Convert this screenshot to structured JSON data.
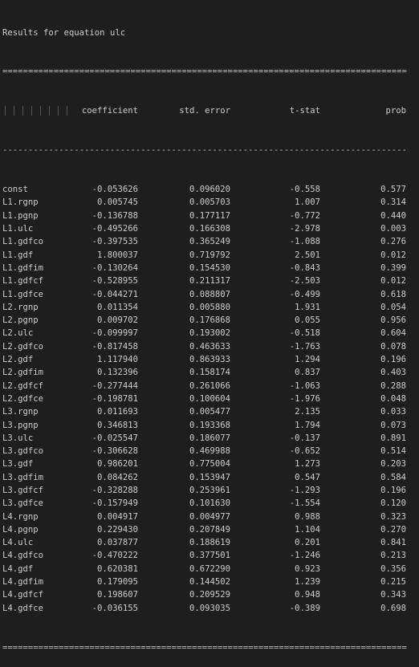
{
  "title": "Results for equation ulc",
  "separator_double": "===============================================================================",
  "separator_single": "-------------------------------------------------------------------------------",
  "columns": {
    "coefficient": "coefficient",
    "std_error": "std. error",
    "t_stat": "t-stat",
    "prob": "prob"
  },
  "rows": [
    {
      "name": "const",
      "coef": "-0.053626",
      "err": "0.096020",
      "t": "-0.558",
      "prob": "0.577"
    },
    {
      "name": "L1.rgnp",
      "coef": "0.005745",
      "err": "0.005703",
      "t": "1.007",
      "prob": "0.314"
    },
    {
      "name": "L1.pgnp",
      "coef": "-0.136788",
      "err": "0.177117",
      "t": "-0.772",
      "prob": "0.440"
    },
    {
      "name": "L1.ulc",
      "coef": "-0.495266",
      "err": "0.166308",
      "t": "-2.978",
      "prob": "0.003"
    },
    {
      "name": "L1.gdfco",
      "coef": "-0.397535",
      "err": "0.365249",
      "t": "-1.088",
      "prob": "0.276"
    },
    {
      "name": "L1.gdf",
      "coef": "1.800037",
      "err": "0.719792",
      "t": "2.501",
      "prob": "0.012"
    },
    {
      "name": "L1.gdfim",
      "coef": "-0.130264",
      "err": "0.154530",
      "t": "-0.843",
      "prob": "0.399"
    },
    {
      "name": "L1.gdfcf",
      "coef": "-0.528955",
      "err": "0.211317",
      "t": "-2.503",
      "prob": "0.012"
    },
    {
      "name": "L1.gdfce",
      "coef": "-0.044271",
      "err": "0.088807",
      "t": "-0.499",
      "prob": "0.618"
    },
    {
      "name": "L2.rgnp",
      "coef": "0.011354",
      "err": "0.005880",
      "t": "1.931",
      "prob": "0.054"
    },
    {
      "name": "L2.pgnp",
      "coef": "0.009702",
      "err": "0.176868",
      "t": "0.055",
      "prob": "0.956"
    },
    {
      "name": "L2.ulc",
      "coef": "-0.099997",
      "err": "0.193002",
      "t": "-0.518",
      "prob": "0.604"
    },
    {
      "name": "L2.gdfco",
      "coef": "-0.817458",
      "err": "0.463633",
      "t": "-1.763",
      "prob": "0.078"
    },
    {
      "name": "L2.gdf",
      "coef": "1.117940",
      "err": "0.863933",
      "t": "1.294",
      "prob": "0.196"
    },
    {
      "name": "L2.gdfim",
      "coef": "0.132396",
      "err": "0.158174",
      "t": "0.837",
      "prob": "0.403"
    },
    {
      "name": "L2.gdfcf",
      "coef": "-0.277444",
      "err": "0.261066",
      "t": "-1.063",
      "prob": "0.288"
    },
    {
      "name": "L2.gdfce",
      "coef": "-0.198781",
      "err": "0.100604",
      "t": "-1.976",
      "prob": "0.048"
    },
    {
      "name": "L3.rgnp",
      "coef": "0.011693",
      "err": "0.005477",
      "t": "2.135",
      "prob": "0.033"
    },
    {
      "name": "L3.pgnp",
      "coef": "0.346813",
      "err": "0.193368",
      "t": "1.794",
      "prob": "0.073"
    },
    {
      "name": "L3.ulc",
      "coef": "-0.025547",
      "err": "0.186077",
      "t": "-0.137",
      "prob": "0.891"
    },
    {
      "name": "L3.gdfco",
      "coef": "-0.306628",
      "err": "0.469988",
      "t": "-0.652",
      "prob": "0.514"
    },
    {
      "name": "L3.gdf",
      "coef": "0.986201",
      "err": "0.775004",
      "t": "1.273",
      "prob": "0.203"
    },
    {
      "name": "L3.gdfim",
      "coef": "0.084262",
      "err": "0.153947",
      "t": "0.547",
      "prob": "0.584"
    },
    {
      "name": "L3.gdfcf",
      "coef": "-0.328288",
      "err": "0.253961",
      "t": "-1.293",
      "prob": "0.196"
    },
    {
      "name": "L3.gdfce",
      "coef": "-0.157949",
      "err": "0.101630",
      "t": "-1.554",
      "prob": "0.120"
    },
    {
      "name": "L4.rgnp",
      "coef": "0.004917",
      "err": "0.004977",
      "t": "0.988",
      "prob": "0.323"
    },
    {
      "name": "L4.pgnp",
      "coef": "0.229430",
      "err": "0.207849",
      "t": "1.104",
      "prob": "0.270"
    },
    {
      "name": "L4.ulc",
      "coef": "0.037877",
      "err": "0.188619",
      "t": "0.201",
      "prob": "0.841"
    },
    {
      "name": "L4.gdfco",
      "coef": "-0.470222",
      "err": "0.377501",
      "t": "-1.246",
      "prob": "0.213"
    },
    {
      "name": "L4.gdf",
      "coef": "0.620381",
      "err": "0.672290",
      "t": "0.923",
      "prob": "0.356"
    },
    {
      "name": "L4.gdfim",
      "coef": "0.179095",
      "err": "0.144502",
      "t": "1.239",
      "prob": "0.215"
    },
    {
      "name": "L4.gdfcf",
      "coef": "0.198607",
      "err": "0.209529",
      "t": "0.948",
      "prob": "0.343"
    },
    {
      "name": "L4.gdfce",
      "coef": "-0.036155",
      "err": "0.093035",
      "t": "-0.389",
      "prob": "0.698"
    }
  ],
  "colors": {
    "background": "#1e1e1e",
    "text": "#cccccc"
  }
}
